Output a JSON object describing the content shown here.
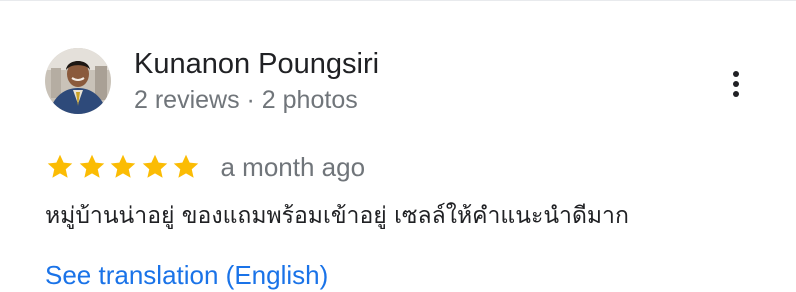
{
  "review": {
    "reviewer_name": "Kunanon Poungsiri",
    "reviewer_meta": "2 reviews · 2 photos",
    "rating": 5,
    "rating_max": 5,
    "date": "a month ago",
    "text": "หมู่บ้านน่าอยู่ ของแถมพร้อมเข้าอยู่ เซลล์ให้คำแนะนำดีมาก",
    "translate_link": "See translation (English)"
  },
  "colors": {
    "star": "#fbbc04",
    "link": "#1a73e8",
    "secondary_text": "#70757a",
    "primary_text": "#202124"
  },
  "icons": {
    "more": "more-vert-icon",
    "star": "star-icon",
    "avatar": "avatar"
  }
}
